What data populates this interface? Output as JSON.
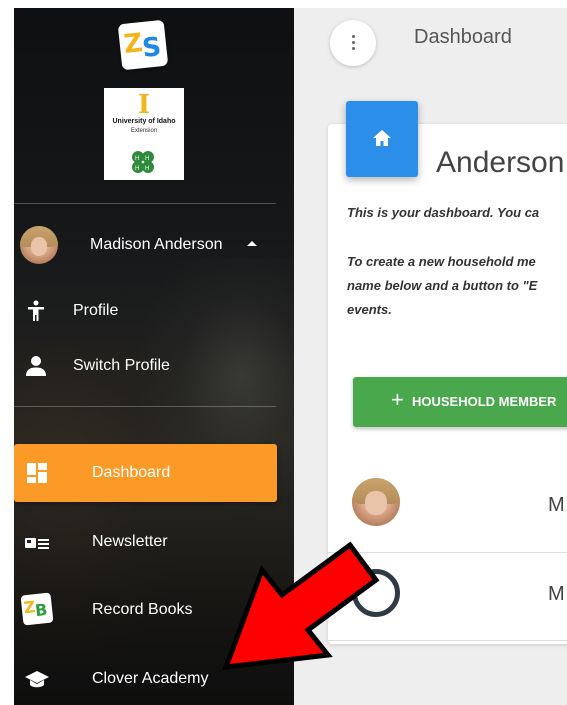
{
  "sidebar": {
    "logo_letters": "ZS",
    "university_logo": {
      "letter": "I",
      "line1": "University of Idaho",
      "line2": "Extension"
    },
    "user": {
      "name": "Madison Anderson"
    },
    "profile_menu": [
      {
        "label": "Profile",
        "icon": "person-walking-icon"
      },
      {
        "label": "Switch Profile",
        "icon": "person-icon"
      }
    ],
    "nav": [
      {
        "label": "Dashboard",
        "icon": "dashboard-grid-icon",
        "active": true
      },
      {
        "label": "Newsletter",
        "icon": "newsletter-icon",
        "active": false
      },
      {
        "label": "Record Books",
        "icon": "record-books-icon",
        "active": false
      },
      {
        "label": "Clover Academy",
        "icon": "graduation-cap-icon",
        "active": false
      }
    ]
  },
  "header": {
    "breadcrumb": "Dashboard"
  },
  "card": {
    "title": "Anderson",
    "intro": "This is your dashboard. You ca",
    "instructions": [
      "To create a new household me",
      "name below and a button to \"E",
      "events."
    ],
    "add_button_plus": "+",
    "add_button_label": "HOUSEHOLD MEMBER",
    "members": [
      {
        "initial": "M"
      },
      {
        "initial": "M"
      }
    ]
  },
  "colors": {
    "accent_orange": "#fb9a26",
    "card_icon_blue": "#2b8ee8",
    "button_green": "#49a84c",
    "arrow_red": "#ff0000"
  }
}
